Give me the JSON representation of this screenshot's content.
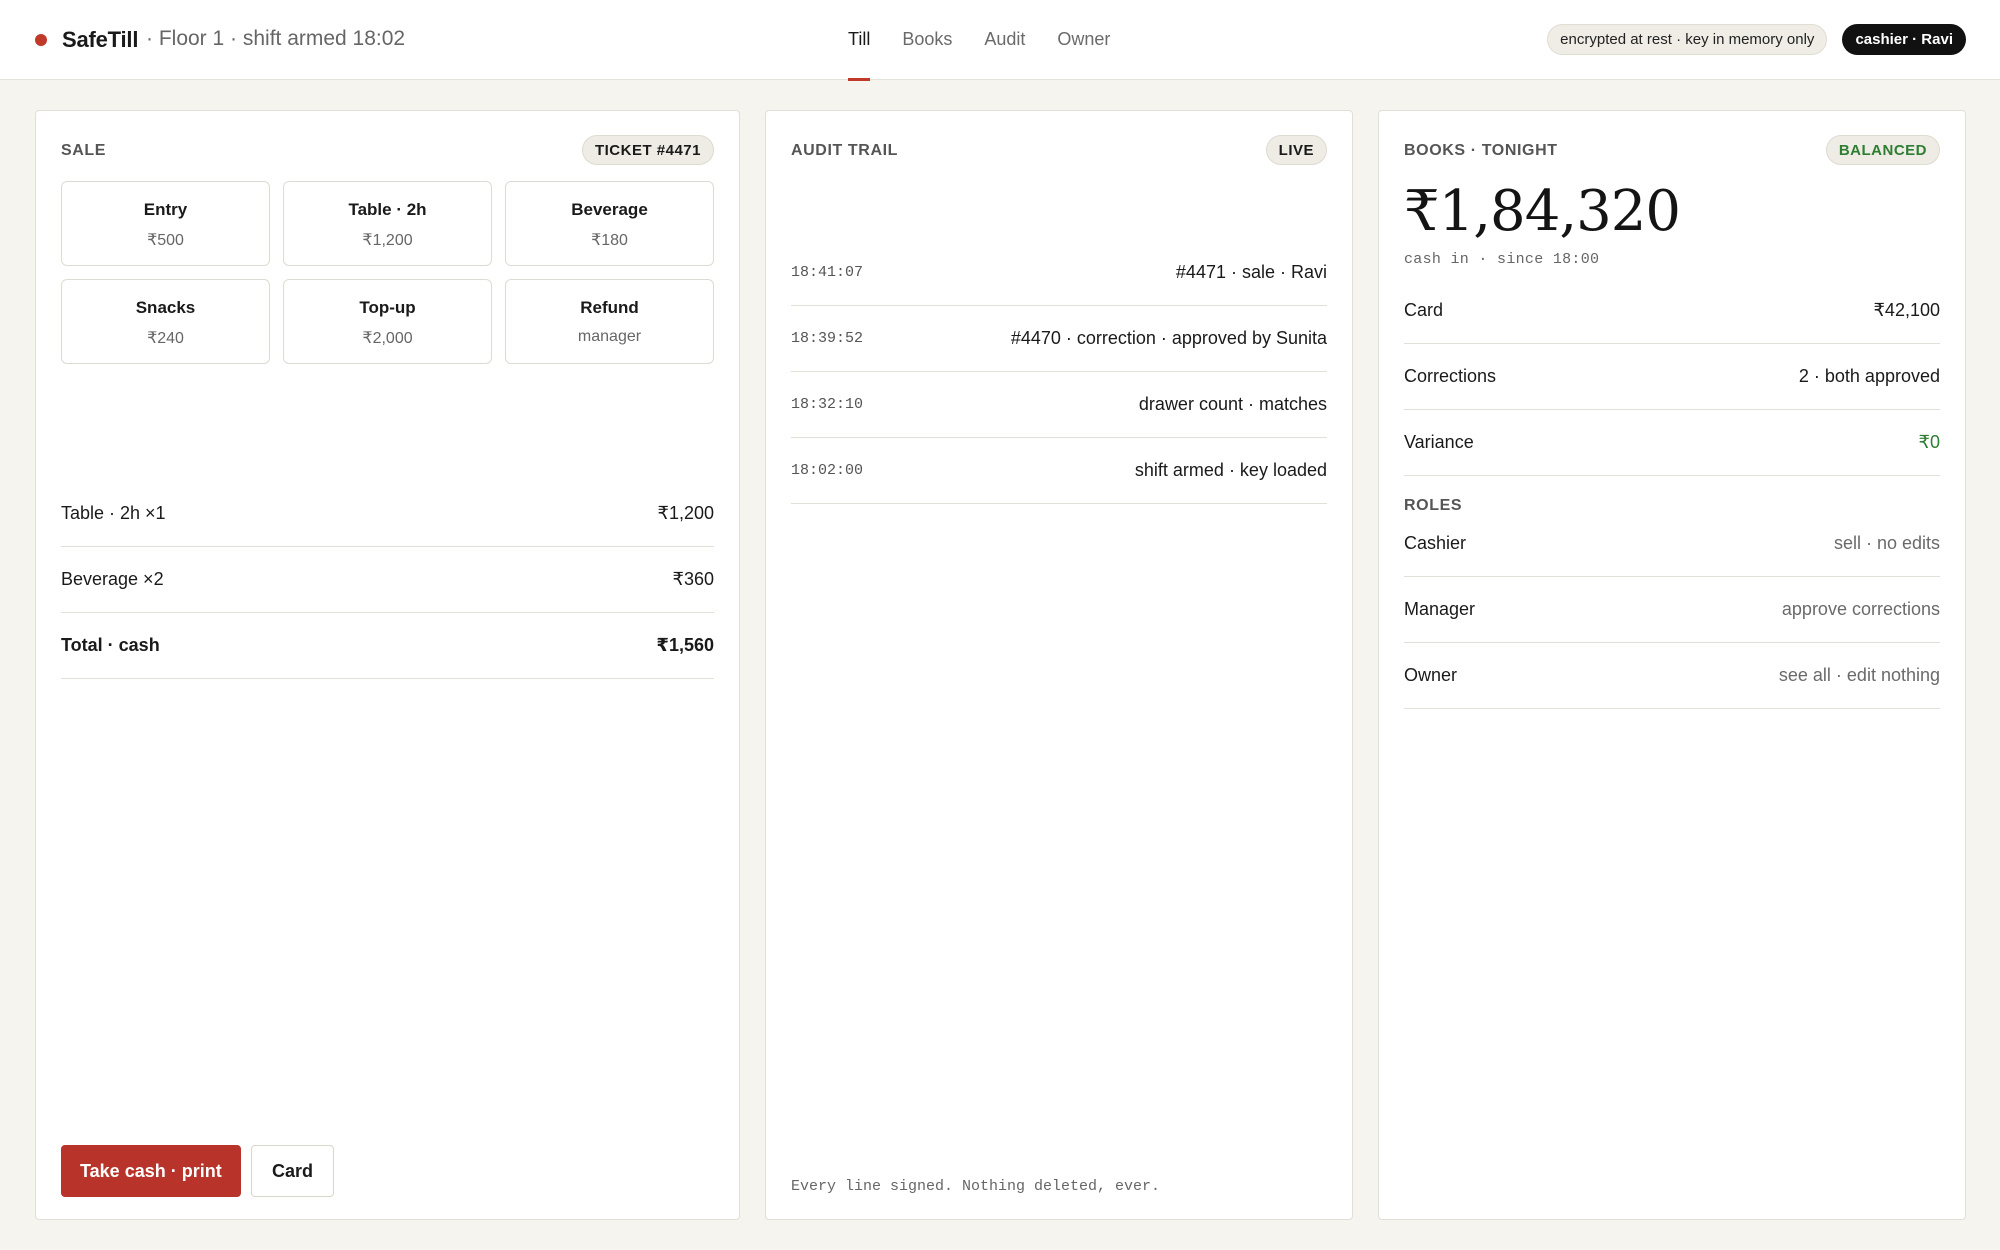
{
  "header": {
    "brand": "SafeTill",
    "subtitle": "· Floor 1 · shift armed 18:02",
    "tabs": [
      "Till",
      "Books",
      "Audit",
      "Owner"
    ],
    "active_tab": "Till",
    "encryption_pill": "encrypted at rest · key in memory only",
    "user_pill": "cashier · Ravi"
  },
  "sale": {
    "title": "SALE",
    "ticket": "TICKET #4471",
    "products": [
      {
        "name": "Entry",
        "price": "₹500"
      },
      {
        "name": "Table · 2h",
        "price": "₹1,200"
      },
      {
        "name": "Beverage",
        "price": "₹180"
      },
      {
        "name": "Snacks",
        "price": "₹240"
      },
      {
        "name": "Top-up",
        "price": "₹2,000"
      },
      {
        "name": "Refund",
        "price": "manager"
      }
    ],
    "lines": [
      {
        "label": "Table · 2h ×1",
        "amount": "₹1,200"
      },
      {
        "label": "Beverage ×2",
        "amount": "₹360"
      }
    ],
    "total": {
      "label": "Total · cash",
      "amount": "₹1,560"
    },
    "primary_button": "Take cash · print",
    "secondary_button": "Card"
  },
  "audit": {
    "title": "AUDIT TRAIL",
    "badge": "LIVE",
    "entries": [
      {
        "time": "18:41:07",
        "event": "#4471 · sale · Ravi"
      },
      {
        "time": "18:39:52",
        "event": "#4470 · correction · approved by Sunita"
      },
      {
        "time": "18:32:10",
        "event": "drawer count · matches"
      },
      {
        "time": "18:02:00",
        "event": "shift armed · key loaded"
      }
    ],
    "footer": "Every line signed. Nothing deleted, ever."
  },
  "books": {
    "title": "BOOKS · TONIGHT",
    "badge": "BALANCED",
    "amount": "₹1,84,320",
    "caption": "cash in · since 18:00",
    "rows": [
      {
        "label": "Card",
        "value": "₹42,100"
      },
      {
        "label": "Corrections",
        "value": "2 · both approved"
      },
      {
        "label": "Variance",
        "value": "₹0"
      }
    ],
    "roles_title": "ROLES",
    "roles": [
      {
        "label": "Cashier",
        "value": "sell · no edits"
      },
      {
        "label": "Manager",
        "value": "approve corrections"
      },
      {
        "label": "Owner",
        "value": "see all · edit nothing"
      }
    ]
  },
  "colors": {
    "accent": "#c0392b",
    "positive": "#2e7d32",
    "background": "#f5f4ef"
  },
  "icons": {
    "status_dot": "status-dot-icon"
  }
}
